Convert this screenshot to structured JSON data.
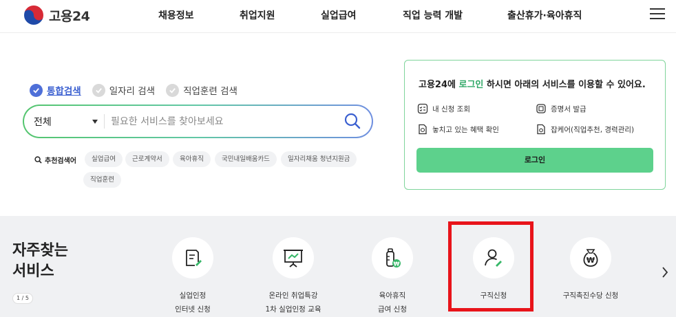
{
  "header": {
    "logo_text": "고용24",
    "nav": [
      "채용정보",
      "취업지원",
      "실업급여",
      "직업 능력 개발",
      "출산휴가·육아휴직"
    ]
  },
  "search": {
    "tabs": [
      {
        "label": "통합검색",
        "active": true
      },
      {
        "label": "일자리 검색",
        "active": false
      },
      {
        "label": "직업훈련 검색",
        "active": false
      }
    ],
    "category": "전체",
    "placeholder": "필요한 서비스를 찾아보세요",
    "recommend_label": "추천검색어",
    "keywords": [
      "실업급여",
      "근로계약서",
      "육아휴직",
      "국민내일배움카드",
      "일자리채움 청년지원금",
      "직업훈련"
    ]
  },
  "login_card": {
    "title_pre": "고용24에 ",
    "title_link": "로그인",
    "title_post": " 하시면 아래의 서비스를 이용할 수 있어요.",
    "items": [
      "내 신청 조회",
      "증명서 발급",
      "놓치고 있는 혜택 확인",
      "잡케어(직업추천, 경력관리)"
    ],
    "button": "로그인"
  },
  "favorites": {
    "title_line1": "자주찾는",
    "title_line2": "서비스",
    "pager": "1 / 5",
    "services": [
      {
        "line1": "실업인정",
        "line2": "인터넷 신청",
        "icon": "document-pen-icon"
      },
      {
        "line1": "온라인 취업특강",
        "line2": "1차 실업인정 교육",
        "icon": "presentation-board-icon"
      },
      {
        "line1": "육아휴직",
        "line2": "급여 신청",
        "icon": "baby-bottle-won-icon"
      },
      {
        "line1": "구직신청",
        "line2": "",
        "icon": "person-pen-icon"
      },
      {
        "line1": "구직촉진수당 신청",
        "line2": "",
        "icon": "money-bag-icon"
      }
    ]
  },
  "colors": {
    "accent_green": "#5dd18c",
    "accent_blue": "#4e6fd8",
    "highlight_red": "#e8141a"
  }
}
